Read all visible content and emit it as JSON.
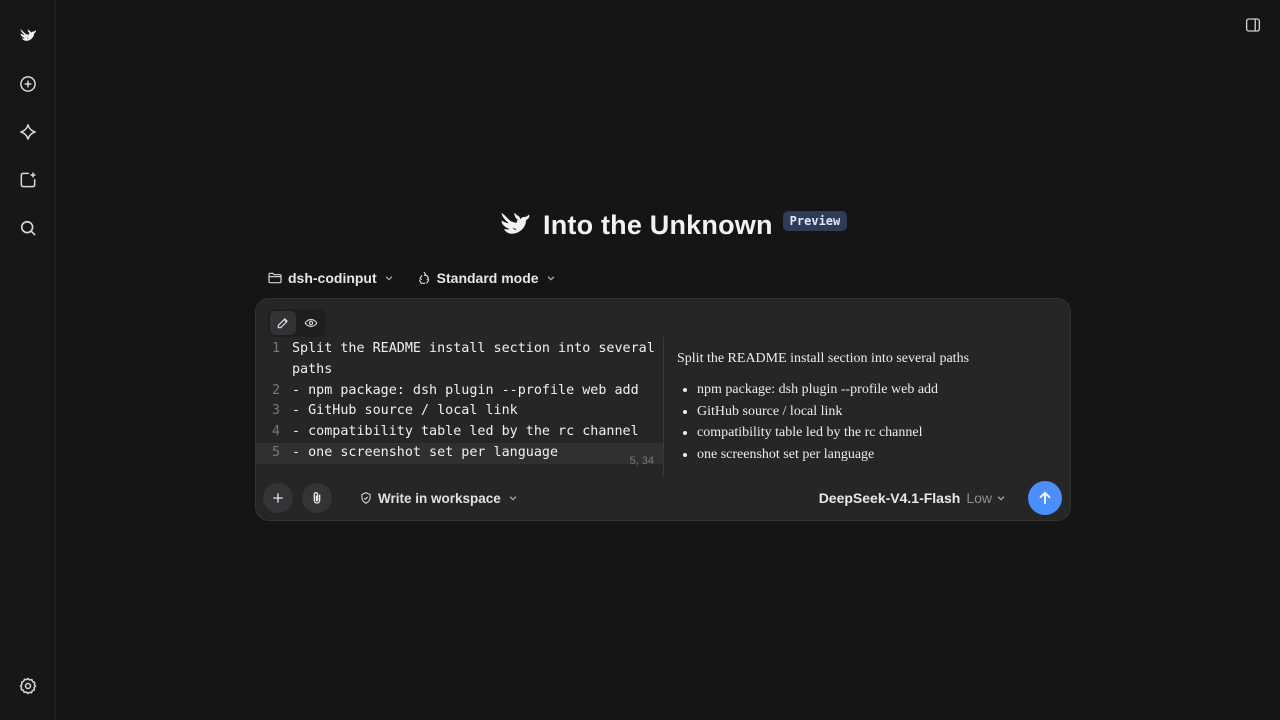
{
  "sidebar": {
    "items": [
      {
        "name": "logo-icon"
      },
      {
        "name": "new-chat-icon"
      },
      {
        "name": "explore-icon"
      },
      {
        "name": "new-project-icon"
      },
      {
        "name": "search-icon"
      },
      {
        "name": "settings-icon"
      }
    ]
  },
  "hero": {
    "title": "Into the Unknown",
    "badge": "Preview"
  },
  "toolbar": {
    "project": "dsh-codinput",
    "mode": "Standard mode"
  },
  "editor": {
    "lines": [
      {
        "num": "1",
        "text": "Split the README install section into several paths"
      },
      {
        "num": "2",
        "text": "- npm package: dsh plugin --profile web add"
      },
      {
        "num": "3",
        "text": "- GitHub source / local link"
      },
      {
        "num": "4",
        "text": "- compatibility table led by the rc channel"
      },
      {
        "num": "5",
        "text": "- one screenshot set per language"
      }
    ],
    "cursor_position": "5, 34"
  },
  "preview": {
    "heading": "Split the README install section into several paths",
    "bullets": [
      "npm package: dsh plugin --profile web add",
      "GitHub source / local link",
      "compatibility table led by the rc channel",
      "one screenshot set per language"
    ]
  },
  "composer": {
    "workspace_label": "Write in workspace",
    "model": "DeepSeek-V4.1-Flash",
    "model_level": "Low"
  },
  "colors": {
    "accent": "#4a8eff",
    "background": "#151515",
    "panel": "#262627"
  }
}
